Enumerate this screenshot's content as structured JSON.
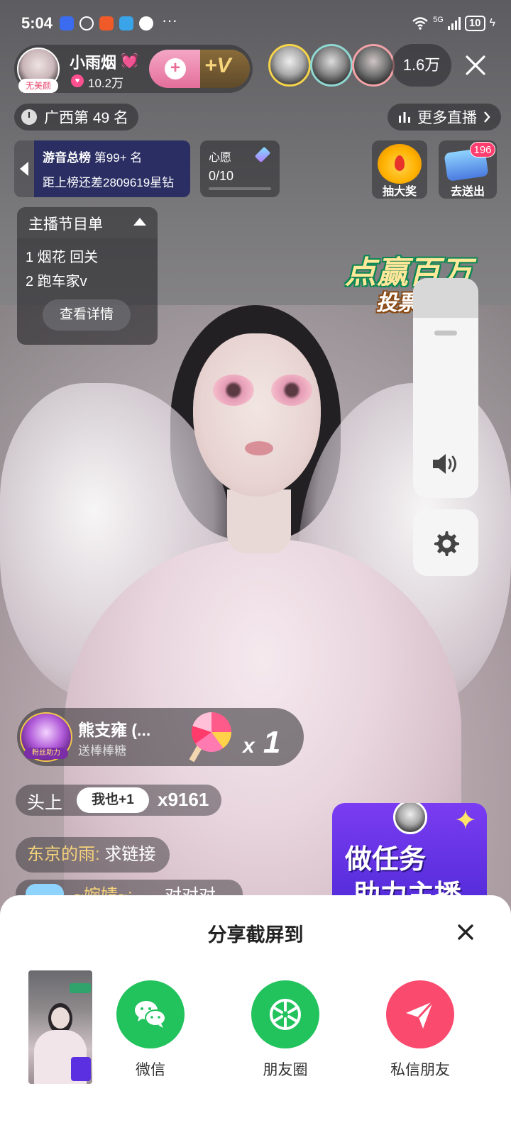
{
  "status_bar": {
    "time": "5:04",
    "more": "···",
    "network": "5G",
    "battery": "10",
    "app_icons": [
      "browser-icon",
      "wechat-icon",
      "app-icon",
      "reader-icon",
      "message-icon"
    ]
  },
  "host": {
    "name": "小雨烟",
    "name_suffix": "💓",
    "beauty_tag": "无美颜",
    "fans": "10.2万",
    "follow_plus": "+",
    "vip_plus": "+V"
  },
  "viewers": {
    "count": "1.6万"
  },
  "rank": {
    "region": "广西第 49 名",
    "more_live": "更多直播"
  },
  "rank_board": {
    "title": "游音总榜",
    "position": "第99+ 名",
    "gap_text": "距上榜还差2809619星钻"
  },
  "wish": {
    "title": "心愿",
    "progress": "0/10",
    "progress_fraction": 0
  },
  "lottery": {
    "label": "抽大奖"
  },
  "send_gift": {
    "label": "去送出",
    "badge": "196"
  },
  "program": {
    "title": "主播节目单",
    "items": [
      "1 烟花 回关",
      "2 跑车家v"
    ],
    "detail_button": "查看详情"
  },
  "vote_banner": {
    "line1": "点赢百万",
    "line2": "投票抽奖"
  },
  "volume": {
    "level": 0.82
  },
  "gift_notice": {
    "sender": "熊支雍 (...",
    "avatar_tag": "粉丝助力",
    "action": "送棒棒糖",
    "multiplier_x": "x",
    "multiplier_n": "1"
  },
  "combo": {
    "title": "头上",
    "me_too": "我也+1",
    "count": "x9161"
  },
  "chat": [
    {
      "user": "东京的雨:",
      "text": "求链接"
    },
    {
      "user": "~婉婧~:",
      "text": "对对对"
    }
  ],
  "task_banner": {
    "line1": "做任务",
    "line2": "助力主播"
  },
  "share_sheet": {
    "title": "分享截屏到",
    "targets": [
      {
        "label": "微信"
      },
      {
        "label": "朋友圈"
      },
      {
        "label": "私信朋友"
      }
    ]
  },
  "colors": {
    "accent_pink": "#fa4a6e",
    "wechat_green": "#22c25d",
    "rank_board_bg": "#2a2e63",
    "task_purple": "#5a30e0"
  }
}
